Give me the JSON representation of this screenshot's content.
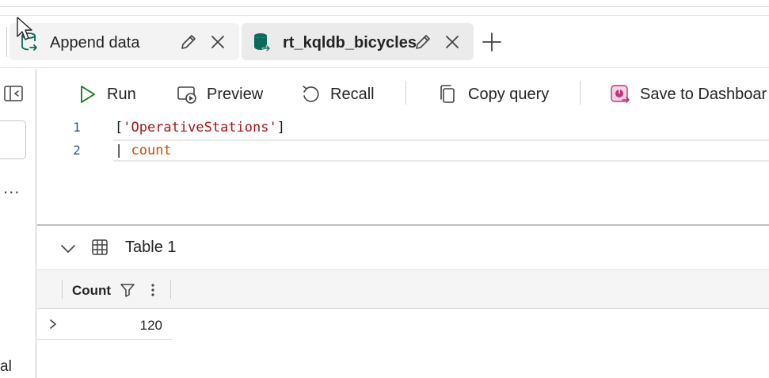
{
  "tabs": [
    {
      "label": "Append data",
      "active": false
    },
    {
      "label": "rt_kqldb_bicycles",
      "active": true
    }
  ],
  "toolbar": {
    "run_label": "Run",
    "preview_label": "Preview",
    "recall_label": "Recall",
    "copy_label": "Copy query",
    "save_label": "Save to Dashboar"
  },
  "editor": {
    "line_numbers": [
      "1",
      "2"
    ],
    "line1": {
      "open": "[",
      "string": "'OperativeStations'",
      "close": "]"
    },
    "line2": {
      "pipe": "| ",
      "keyword": "count"
    }
  },
  "left_rail": {
    "more": "...",
    "partial_text": "al"
  },
  "results": {
    "table_title": "Table 1",
    "columns": [
      "Count"
    ],
    "rows": [
      [
        "120"
      ]
    ]
  },
  "colors": {
    "run_green": "#107c10",
    "string_red": "#a31515",
    "keyword_orange": "#c84f00",
    "line_number_blue": "#2b5797",
    "dashboard_pink": "#c4307a",
    "kql_db_teal": "#0b6a5b"
  },
  "icons": {
    "append_tab": "database-arrow-icon",
    "rt_tab": "kql-database-icon",
    "edit": "pencil-icon",
    "close": "close-icon",
    "add": "plus-icon",
    "run": "play-icon",
    "preview": "preview-icon",
    "recall": "recall-icon",
    "copy": "copy-icon",
    "save": "dashboard-icon",
    "table": "table-icon",
    "filter": "filter-icon",
    "menu": "kebab-icon"
  }
}
